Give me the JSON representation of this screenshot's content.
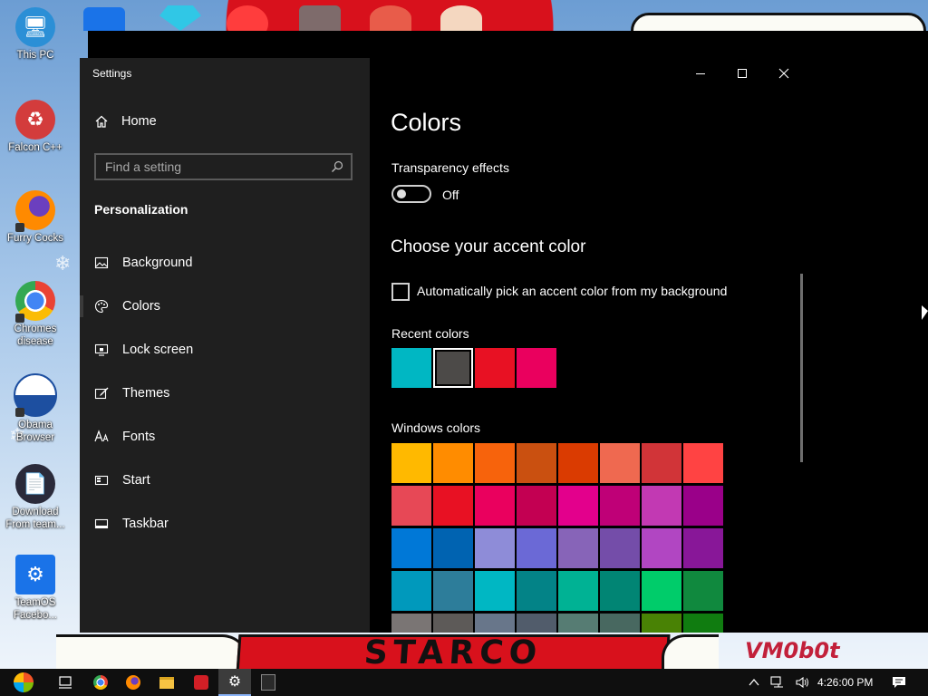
{
  "desktop": {
    "icons": [
      {
        "label": "This PC",
        "icon": "monitor-icon"
      },
      {
        "label": "Falcon C++",
        "icon": "recycle-icon"
      },
      {
        "label": "Furry Cocks",
        "icon": "firefox-icon"
      },
      {
        "label": "Chromes disease",
        "icon": "chrome-icon"
      },
      {
        "label": "Obama Browser",
        "icon": "obama-logo-icon"
      },
      {
        "label": "Download From team...",
        "icon": "document-icon"
      },
      {
        "label": "TeamOS Facebo...",
        "icon": "gear-icon"
      }
    ],
    "wallpaper_text": {
      "banner": "STARCO",
      "sign": "VM0b0t"
    }
  },
  "window": {
    "title": "Settings",
    "controls": {
      "minimize": "minimize-icon",
      "maximize": "maximize-icon",
      "close": "close-icon"
    }
  },
  "sidebar": {
    "home_label": "Home",
    "search_placeholder": "Find a setting",
    "section_title": "Personalization",
    "items": [
      {
        "label": "Background",
        "icon": "image-icon"
      },
      {
        "label": "Colors",
        "icon": "palette-icon",
        "selected": true
      },
      {
        "label": "Lock screen",
        "icon": "monitor-lock-icon"
      },
      {
        "label": "Themes",
        "icon": "brush-icon"
      },
      {
        "label": "Fonts",
        "icon": "fonts-icon"
      },
      {
        "label": "Start",
        "icon": "start-icon"
      },
      {
        "label": "Taskbar",
        "icon": "taskbar-icon"
      }
    ]
  },
  "content": {
    "title": "Colors",
    "transparency": {
      "label": "Transparency effects",
      "state": "Off",
      "on": false
    },
    "accent_heading": "Choose your accent color",
    "auto_pick": {
      "label": "Automatically pick an accent color from my background",
      "checked": false
    },
    "recent_label": "Recent colors",
    "recent_colors": [
      "#00b7c3",
      "#4c4a48",
      "#e81123",
      "#ea005e"
    ],
    "recent_selected_index": 1,
    "windows_label": "Windows colors",
    "windows_colors": [
      [
        "#ffb900",
        "#ff8c00",
        "#f7630c",
        "#ca5010",
        "#da3b01",
        "#ef6950",
        "#d13438",
        "#ff4343"
      ],
      [
        "#e74856",
        "#e81123",
        "#ea005e",
        "#c30052",
        "#e3008c",
        "#bf0077",
        "#c239b3",
        "#9a0089"
      ],
      [
        "#0078d7",
        "#0063b1",
        "#8e8cd8",
        "#6b69d6",
        "#8764b8",
        "#744da9",
        "#b146c2",
        "#881798"
      ],
      [
        "#0099bc",
        "#2d7d9a",
        "#00b7c3",
        "#038387",
        "#00b294",
        "#018574",
        "#00cc6a",
        "#10893e"
      ],
      [
        "#7a7574",
        "#5d5a58",
        "#68768a",
        "#515c6b",
        "#567c73",
        "#486860",
        "#498205",
        "#107c10"
      ]
    ]
  },
  "taskbar": {
    "items": [
      {
        "name": "start-button",
        "icon": "windows-logo-icon"
      },
      {
        "name": "task-view-button",
        "icon": "task-view-icon"
      },
      {
        "name": "chrome-taskbar-button",
        "icon": "chrome-icon"
      },
      {
        "name": "firefox-taskbar-button",
        "icon": "firefox-icon"
      },
      {
        "name": "file-explorer-taskbar-button",
        "icon": "folder-icon"
      },
      {
        "name": "red-app-taskbar-button",
        "icon": "red-app-icon"
      },
      {
        "name": "settings-taskbar-button",
        "icon": "gear-icon",
        "active": true
      },
      {
        "name": "epic-games-taskbar-button",
        "icon": "epic-games-icon"
      }
    ],
    "clock": "4:26:00 PM",
    "tray_icons": [
      "chevron-up-icon",
      "network-icon",
      "volume-icon",
      "notification-icon"
    ]
  }
}
